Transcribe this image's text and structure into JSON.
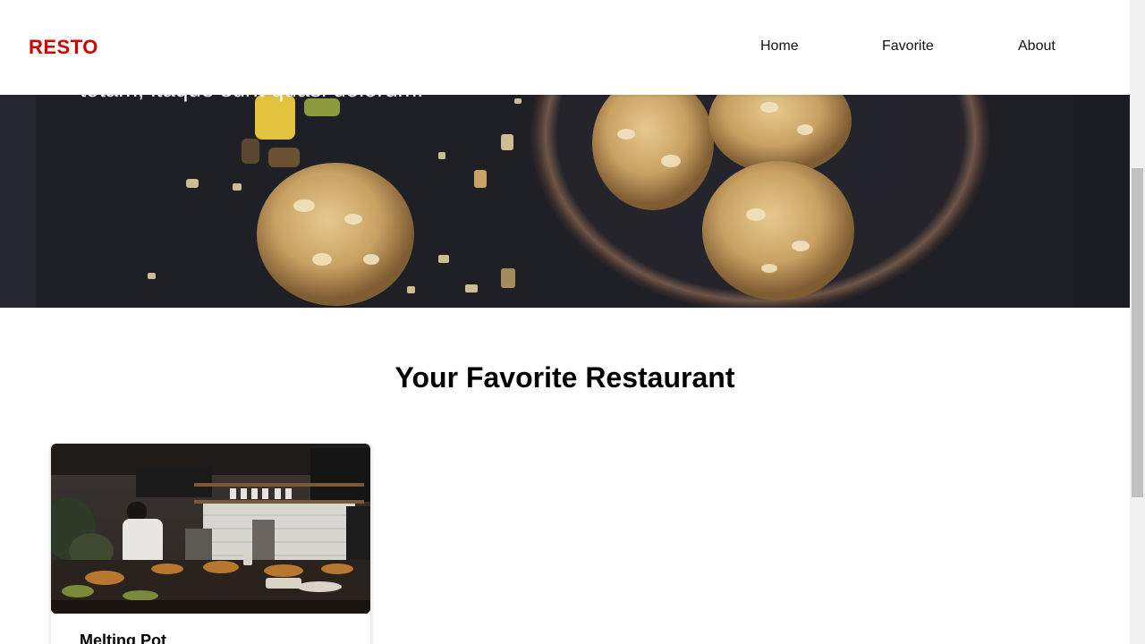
{
  "navbar": {
    "brand": "RESTO",
    "links": [
      "Home",
      "Favorite",
      "About"
    ]
  },
  "hero": {
    "text": "totam, itaque sunt quasi dolorum."
  },
  "main": {
    "title": "Your Favorite Restaurant",
    "restaurants": [
      {
        "name": "Melting Pot"
      }
    ]
  },
  "colors": {
    "brand": "#d40000",
    "hero_background": "#1f1f26"
  }
}
